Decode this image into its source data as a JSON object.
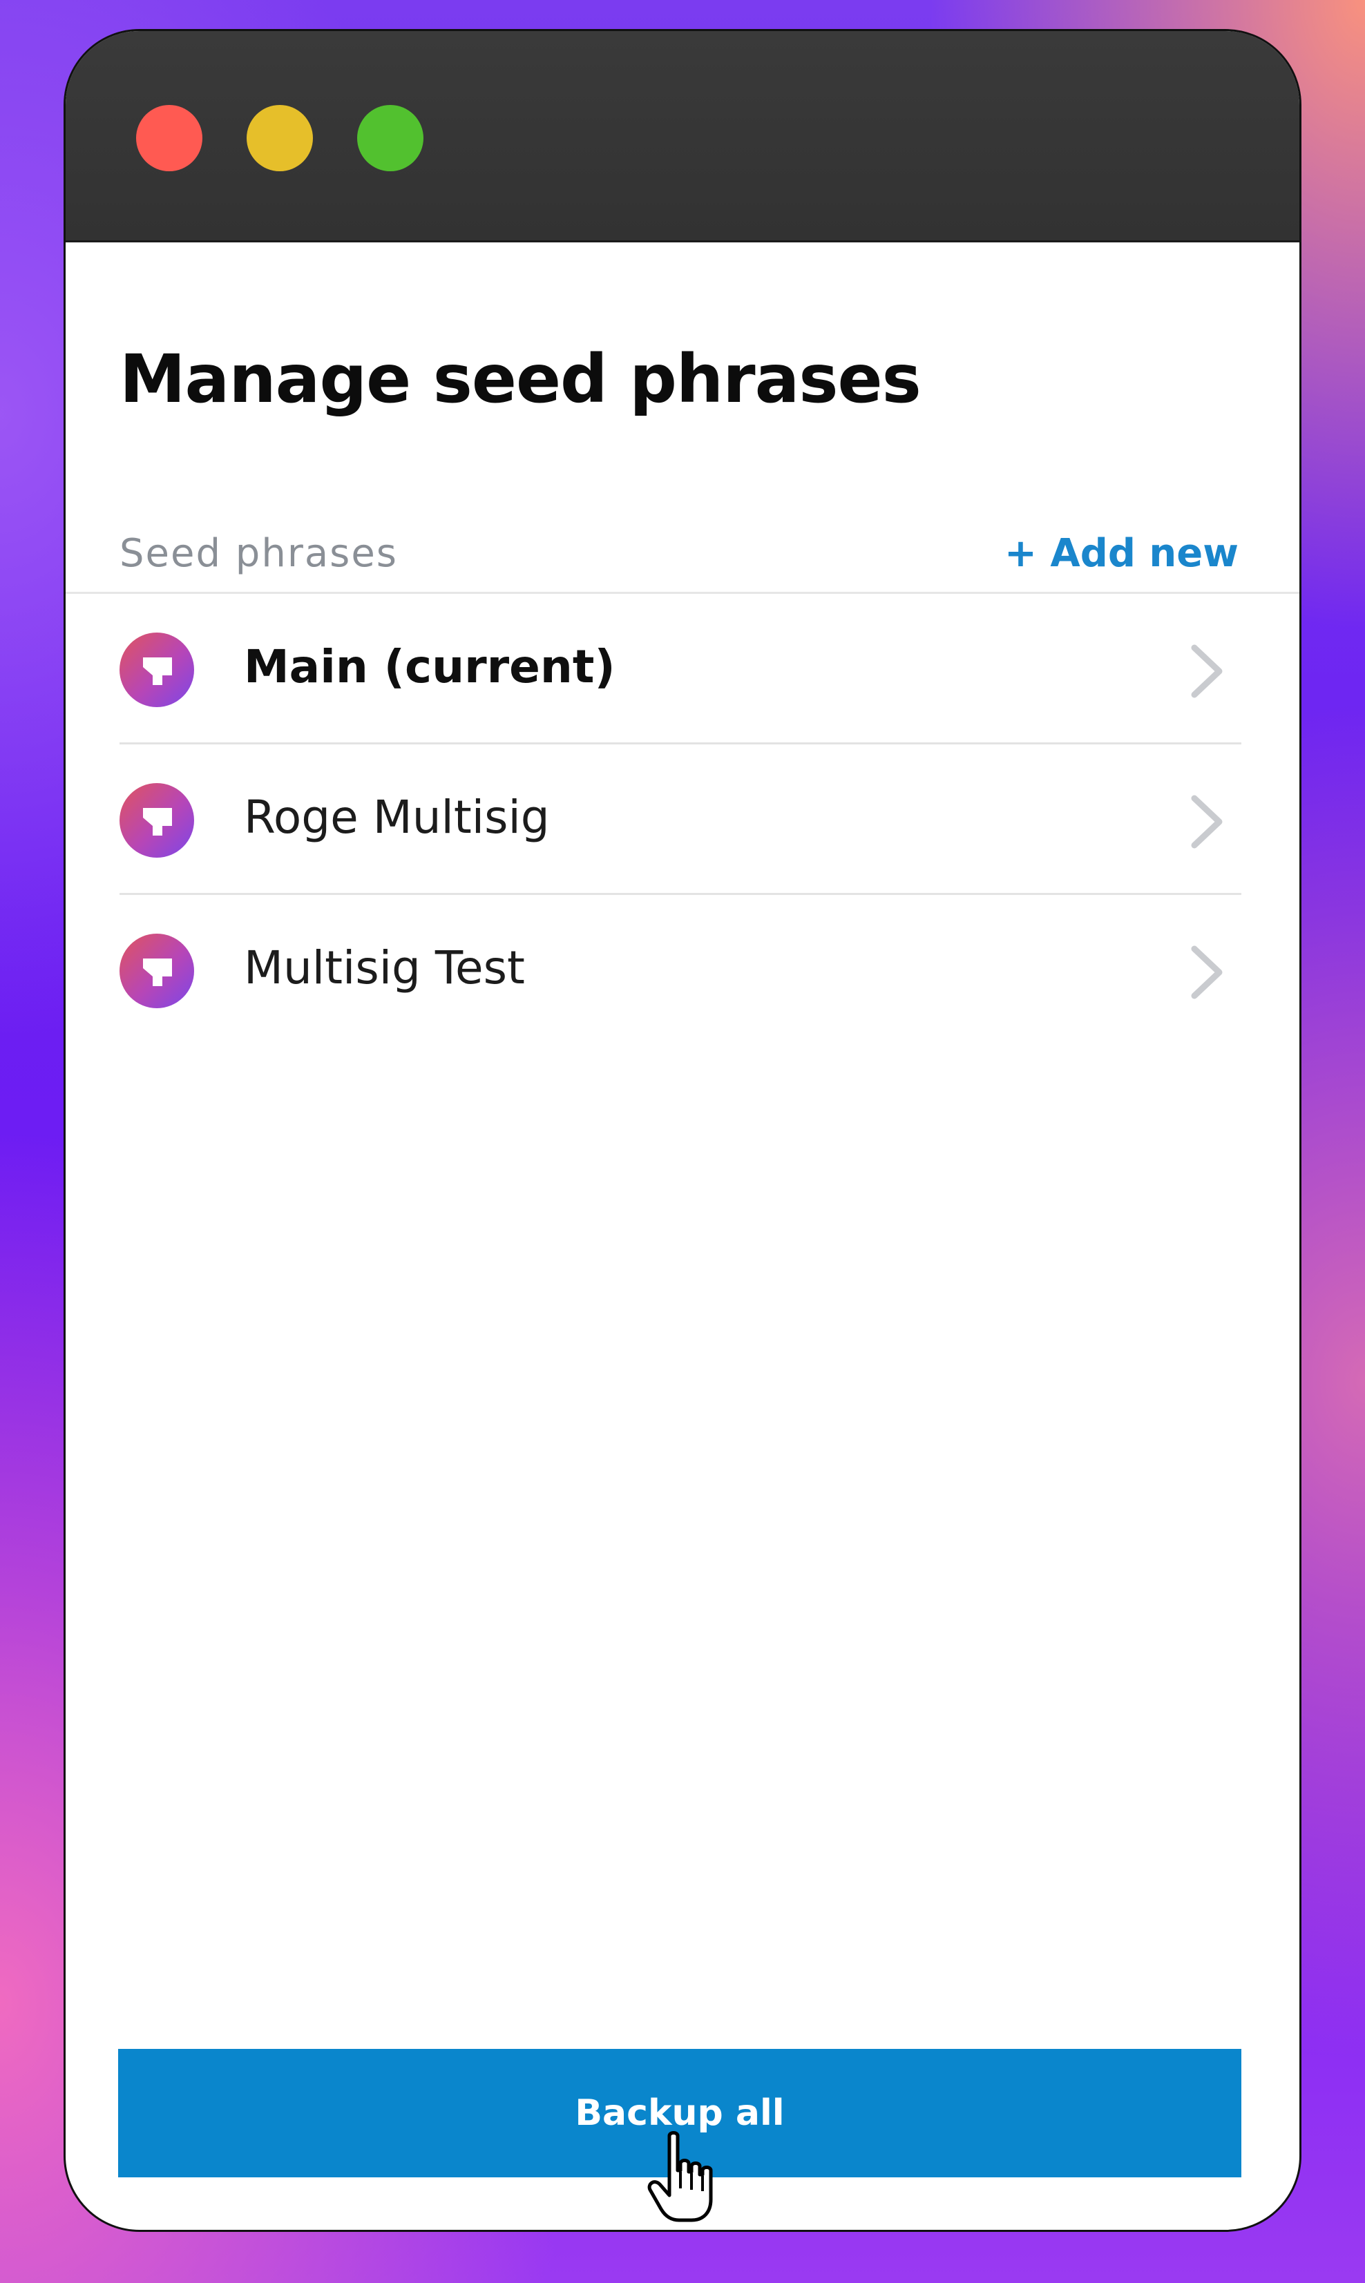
{
  "window": {
    "controls": [
      "close",
      "minimize",
      "maximize"
    ]
  },
  "page": {
    "title": "Manage seed phrases"
  },
  "section": {
    "label": "Seed phrases",
    "add_new_label": "+ Add new"
  },
  "seed_phrases": [
    {
      "name": "Main (current)",
      "current": true,
      "icon": "seed-phrase-icon"
    },
    {
      "name": "Roge Multisig",
      "current": false,
      "icon": "seed-phrase-icon"
    },
    {
      "name": "Multisig Test",
      "current": false,
      "icon": "seed-phrase-icon"
    }
  ],
  "actions": {
    "backup_all_label": "Backup all"
  },
  "colors": {
    "accent": "#1a86cc",
    "button": "#0a86cc",
    "close": "#ff5a52",
    "minimize": "#e6bf2a",
    "maximize": "#52c12f"
  }
}
